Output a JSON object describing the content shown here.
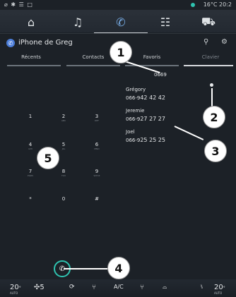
{
  "status_bar": {
    "left_icons": "⌀ ✱ ☰ □",
    "temperature": "16°C",
    "time": "20:2"
  },
  "nav": {
    "items": [
      {
        "name": "home-icon",
        "glyph": "⌂"
      },
      {
        "name": "music-icon",
        "glyph": "♫"
      },
      {
        "name": "phone-icon",
        "glyph": "✆"
      },
      {
        "name": "apps-icon",
        "glyph": "☷"
      },
      {
        "name": "car-icon",
        "glyph": "⛟"
      }
    ]
  },
  "header": {
    "title": "iPhone de Greg"
  },
  "tabs": [
    {
      "label": "Récents"
    },
    {
      "label": "Contacts"
    },
    {
      "label": "Favoris"
    },
    {
      "label": "Clavier"
    }
  ],
  "dialer": {
    "entered_number": "0669",
    "keys": [
      {
        "digit": "1",
        "letters": ""
      },
      {
        "digit": "2",
        "letters": "ABC"
      },
      {
        "digit": "3",
        "letters": "DEF"
      },
      {
        "digit": "4",
        "letters": "GHI"
      },
      {
        "digit": "5",
        "letters": "JKL"
      },
      {
        "digit": "6",
        "letters": "MNO"
      },
      {
        "digit": "7",
        "letters": "PQRS"
      },
      {
        "digit": "8",
        "letters": "TUV"
      },
      {
        "digit": "9",
        "letters": "WXYZ"
      },
      {
        "digit": "*",
        "letters": ""
      },
      {
        "digit": "0",
        "letters": ""
      },
      {
        "digit": "#",
        "letters": ""
      }
    ]
  },
  "suggestions": [
    {
      "name": "Grégory",
      "number_prefix": "066-9",
      "number_rest": "42 42 42"
    },
    {
      "name": "Jeremie",
      "number_prefix": "066-9",
      "number_rest": "27 27 27"
    },
    {
      "name": "Joel",
      "number_prefix": "066-9",
      "number_rest": "25 25 25"
    }
  ],
  "callouts": [
    "1",
    "2",
    "3",
    "4",
    "5"
  ],
  "bottom_bar": {
    "temp_left": "20",
    "temp_left_unit": "°",
    "temp_left_small": "AUTO",
    "fan_speed": "5",
    "ac_label": "A/C",
    "temp_right": "20",
    "temp_right_unit": "°",
    "temp_right_small": "AUTO"
  }
}
